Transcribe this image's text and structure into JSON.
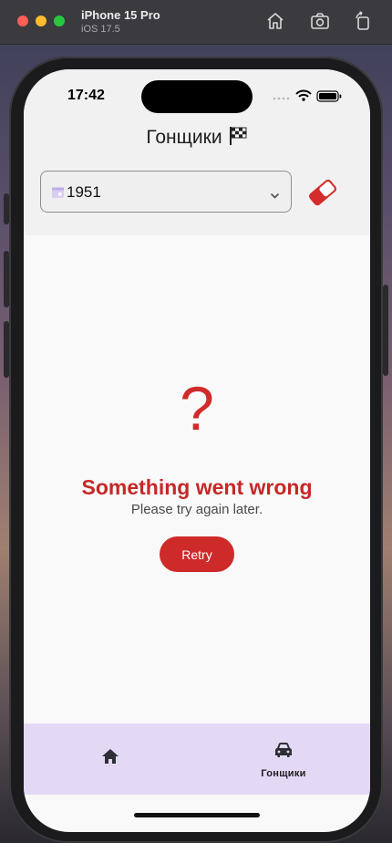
{
  "simulator": {
    "device_name": "iPhone 15 Pro",
    "os_version": "iOS 17.5"
  },
  "status_bar": {
    "time": "17:42"
  },
  "header": {
    "title": "Гонщики",
    "title_icon": "checkered-flag-icon"
  },
  "filter": {
    "selected_year": "1951",
    "leading_icon": "calendar-icon",
    "trailing_icon": "chevron-down-icon",
    "clear_icon": "eraser-icon"
  },
  "error": {
    "mark": "?",
    "title": "Something went wrong",
    "message": "Please try again later.",
    "retry_label": "Retry"
  },
  "tabbar": {
    "items": [
      {
        "icon": "home-icon",
        "label": ""
      },
      {
        "icon": "car-icon",
        "label": "Гонщики"
      }
    ]
  },
  "colors": {
    "accent_red": "#cf2a2a",
    "tabbar_bg": "#e4d9f5"
  }
}
